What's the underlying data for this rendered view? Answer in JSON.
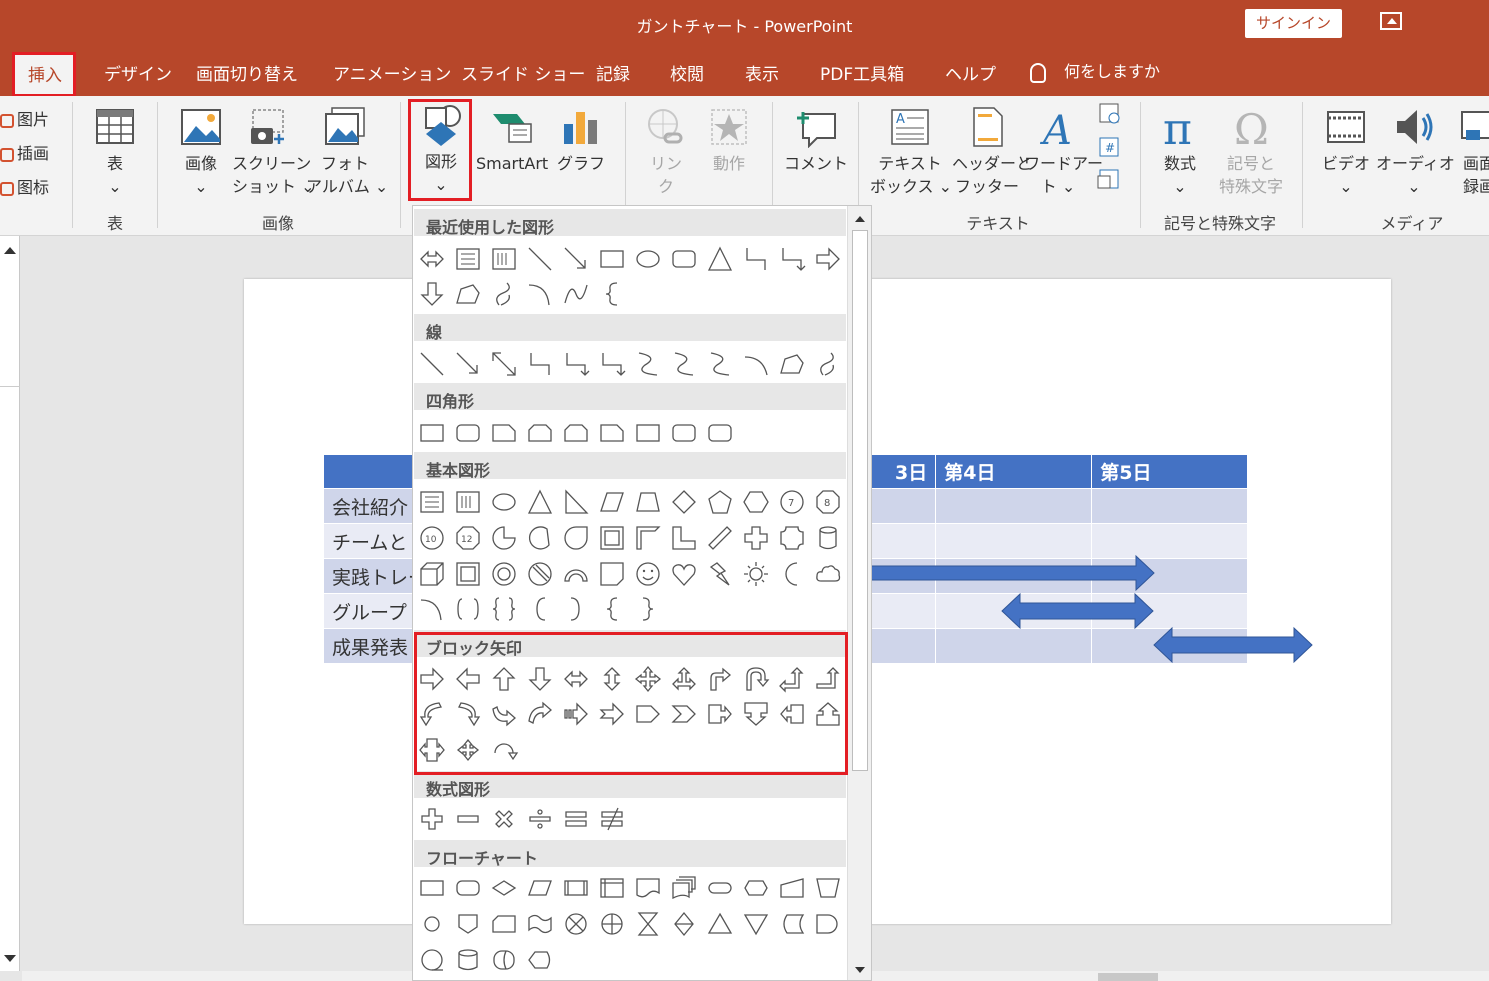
{
  "window": {
    "title": "ガントチャート  -  PowerPoint",
    "signin": "サインイン"
  },
  "tabs": [
    {
      "label": "挿入",
      "active": true
    },
    {
      "label": "デザイン"
    },
    {
      "label": "画面切り替え"
    },
    {
      "label": "アニメーション"
    },
    {
      "label": "スライド ショー"
    },
    {
      "label": "記録"
    },
    {
      "label": "校閲"
    },
    {
      "label": "表示"
    },
    {
      "label": "PDF工具箱"
    },
    {
      "label": "ヘルプ"
    }
  ],
  "tellme": "何をしますか",
  "ribbon": {
    "left_items": [
      "图片",
      "插画",
      "图标"
    ],
    "table": {
      "btn": "表",
      "group": "表"
    },
    "images": {
      "image": "画像",
      "screenshot_1": "スクリーン",
      "screenshot_2": "ショット",
      "album_1": "フォト",
      "album_2": "アルバム",
      "group": "画像"
    },
    "shapes": "図形",
    "smartart": "SmartArt",
    "graph": "グラフ",
    "link_1": "リン",
    "link_2": "ク",
    "action": "動作",
    "comment": "コメント",
    "text": {
      "textbox_1": "テキスト",
      "textbox_2": "ボックス",
      "header_1": "ヘッダーと",
      "header_2": "フッター",
      "wordart_1": "ワードアー",
      "wordart_2": "ト",
      "group": "テキスト"
    },
    "symbols": {
      "equation": "数式",
      "symbol_1": "記号と",
      "symbol_2": "特殊文字",
      "group": "記号と特殊文字"
    },
    "media": {
      "video": "ビデオ",
      "audio": "オーディオ",
      "screenrec_1": "画面",
      "screenrec_2": "録画",
      "group": "メディア"
    }
  },
  "slide_table": {
    "headers": [
      "",
      "3日",
      "第4日",
      "第5日"
    ],
    "rows": [
      "会社紹介",
      "チームと",
      "実践トレー",
      "グループ",
      "成果発表"
    ]
  },
  "gallery": {
    "sections": [
      "最近使用した図形",
      "線",
      "四角形",
      "基本図形",
      "ブロック矢印",
      "数式図形",
      "フローチャート"
    ]
  },
  "colors": {
    "accent": "#b7472a",
    "highlight": "#e31e24",
    "table_header": "#4472c4",
    "arrow": "#4472c4"
  }
}
